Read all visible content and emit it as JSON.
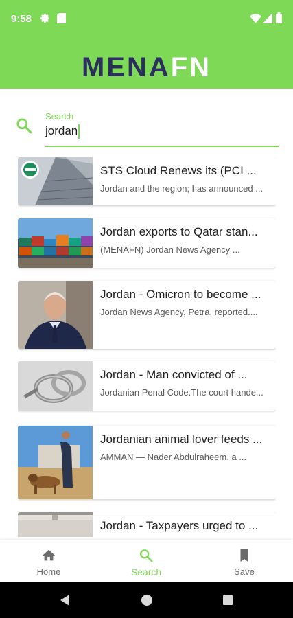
{
  "status_bar": {
    "time": "9:58",
    "icons": [
      "gear-icon",
      "sd-card-icon",
      "wifi-icon",
      "signal-icon",
      "battery-icon"
    ]
  },
  "header": {
    "logo_part1": "MENA",
    "logo_part2": "FN",
    "bg_color": "#7ed957",
    "logo_color": "#2b2f5c"
  },
  "search": {
    "label": "Search",
    "value": "jordan",
    "accent_color": "#7ed957"
  },
  "articles": [
    {
      "title": "STS Cloud Renews its (PCI ...",
      "description": "Jordan and the region; has announced ..."
    },
    {
      "title": "Jordan exports to Qatar stan...",
      "description": "(MENAFN) Jordan News Agency ..."
    },
    {
      "title": "Jordan - Omicron to become ...",
      "description": "Jordan News Agency, Petra, reported...."
    },
    {
      "title": "Jordan - Man convicted of ...",
      "description": "Jordanian Penal Code.The court hande..."
    },
    {
      "title": "Jordanian animal lover feeds ...",
      "description": "AMMAN — Nader Abdulraheem, a ..."
    },
    {
      "title": "Jordan - Taxpayers urged to ...",
      "description": ""
    }
  ],
  "bottom_nav": {
    "items": [
      {
        "label": "Home",
        "icon": "home-icon",
        "active": false
      },
      {
        "label": "Search",
        "icon": "search-icon",
        "active": true
      },
      {
        "label": "Save",
        "icon": "bookmark-icon",
        "active": false
      }
    ]
  },
  "system_nav": [
    "back-icon",
    "home-circle-icon",
    "recents-icon"
  ]
}
